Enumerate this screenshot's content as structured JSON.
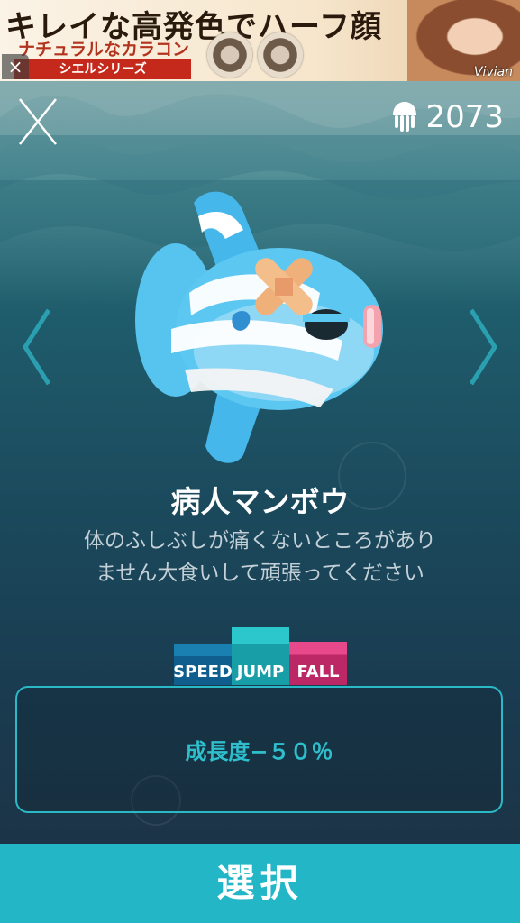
{
  "ad": {
    "headline": "キレイな高発色でハーフ顔",
    "subline": "ナチュラルなカラコン",
    "series": "シエルシリーズ",
    "brand": "Vivian",
    "close_icon": "close-icon"
  },
  "header": {
    "close_icon": "close-x-icon",
    "coin_icon": "jellyfish-icon",
    "coins": "2073"
  },
  "character": {
    "name": "病人マンボウ",
    "description_line1": "体のふしぶしが痛くないところがあり",
    "description_line2": "ません大食いして頑張ってください"
  },
  "stats": {
    "speed_label": "SPEED",
    "jump_label": "JUMP",
    "fall_label": "FALL",
    "speed_color": "#0f5e8e",
    "jump_color": "#179ea7",
    "fall_color": "#bc2865"
  },
  "panel": {
    "growth_text": "成長度−５０％"
  },
  "footer": {
    "select_label": "選択"
  }
}
